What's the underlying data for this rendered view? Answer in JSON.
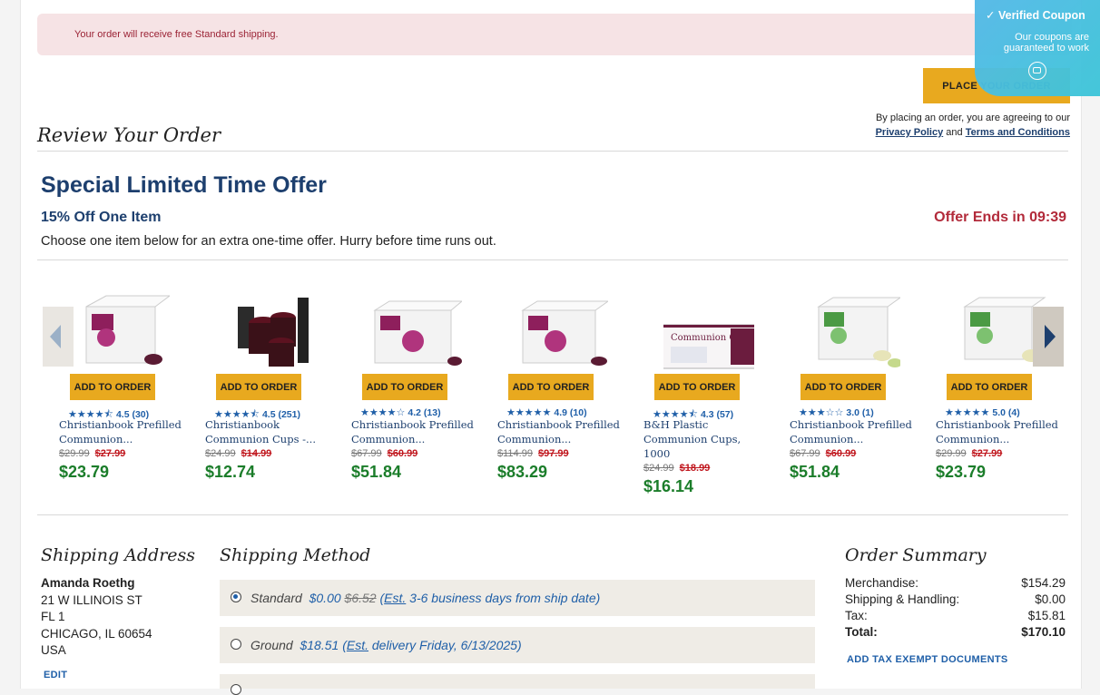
{
  "banner": {
    "text": "Your order will receive free Standard shipping."
  },
  "header": {
    "place_order_label": "PLACE YOUR ORDER",
    "agreement_text": "By placing an order, you are agreeing to our",
    "privacy_link": "Privacy Policy",
    "and_text": "and",
    "terms_link": "Terms and Conditions"
  },
  "review": {
    "title": "Review Your Order"
  },
  "offer": {
    "title": "Special Limited Time Offer",
    "subtitle": "15% Off One Item",
    "ends": "Offer Ends in 09:39",
    "description": "Choose one item below for an extra one-time offer. Hurry before time runs out."
  },
  "products": [
    {
      "add_label": "ADD TO ORDER",
      "stars": "★★★★⯪",
      "reviews": "4.5 (30)",
      "title1": "Christianbook Prefilled",
      "title2": "Communion...",
      "title3": "",
      "was": "$29.99",
      "sale": "$27.99",
      "offer_price": "$23.79"
    },
    {
      "add_label": "ADD TO ORDER",
      "stars": "★★★★⯪",
      "reviews": "4.5 (251)",
      "title1": "Christianbook",
      "title2": "Communion Cups -...",
      "title3": "",
      "was": "$24.99",
      "sale": "$14.99",
      "offer_price": "$12.74"
    },
    {
      "add_label": "ADD TO ORDER",
      "stars": "★★★★☆",
      "reviews": "4.2 (13)",
      "title1": "Christianbook Prefilled",
      "title2": "Communion...",
      "title3": "",
      "was": "$67.99",
      "sale": "$60.99",
      "offer_price": "$51.84"
    },
    {
      "add_label": "ADD TO ORDER",
      "stars": "★★★★★",
      "reviews": "4.9 (10)",
      "title1": "Christianbook Prefilled",
      "title2": "Communion...",
      "title3": "",
      "was": "$114.99",
      "sale": "$97.99",
      "offer_price": "$83.29"
    },
    {
      "add_label": "ADD TO ORDER",
      "stars": "★★★★⯪",
      "reviews": "4.3 (57)",
      "title1": "B&H Plastic",
      "title2": "Communion Cups,",
      "title3": "1000",
      "was": "$24.99",
      "sale": "$18.99",
      "offer_price": "$16.14",
      "box_label": "Communion Cups"
    },
    {
      "add_label": "ADD TO ORDER",
      "stars": "★★★☆☆",
      "reviews": "3.0 (1)",
      "title1": "Christianbook Prefilled",
      "title2": "Communion...",
      "title3": "",
      "was": "$67.99",
      "sale": "$60.99",
      "offer_price": "$51.84"
    },
    {
      "add_label": "ADD TO ORDER",
      "stars": "★★★★★",
      "reviews": "5.0 (4)",
      "title1": "Christianbook Prefilled",
      "title2": "Communion...",
      "title3": "",
      "was": "$29.99",
      "sale": "$27.99",
      "offer_price": "$23.79"
    }
  ],
  "shipping_address": {
    "heading": "Shipping Address",
    "name": "Amanda Roethg",
    "line1": "21 W ILLINOIS ST",
    "line2": "FL 1",
    "line3": "CHICAGO, IL 60654",
    "line4": "USA",
    "edit_label": "EDIT"
  },
  "shipping_method": {
    "heading": "Shipping Method",
    "options": [
      {
        "name": "Standard",
        "price": "$0.00",
        "old_price": "$6.52",
        "est_prefix": "(",
        "est": "Est.",
        "detail": " 3-6 business days from ship date)",
        "selected": true
      },
      {
        "name": "Ground",
        "price": "$18.51",
        "old_price": "",
        "est_prefix": "(",
        "est": "Est.",
        "detail": " delivery Friday, 6/13/2025)",
        "selected": false
      }
    ]
  },
  "order_summary": {
    "heading": "Order Summary",
    "rows": [
      {
        "label": "Merchandise:",
        "value": "$154.29"
      },
      {
        "label": "Shipping & Handling:",
        "value": "$0.00"
      },
      {
        "label": "Tax:",
        "value": "$15.81"
      },
      {
        "label": "Total:",
        "value": "$170.10"
      }
    ],
    "tax_exempt_label": "ADD TAX EXEMPT DOCUMENTS"
  },
  "coupon_widget": {
    "title": "Verified Coupon",
    "subtitle": "Our coupons are guaranteed to work"
  },
  "colors": {
    "accent_gold": "#e8a91f",
    "brand_navy": "#1d3f6e",
    "offer_green": "#1b7d2a",
    "sale_red": "#c0161d",
    "banner_pink": "#f6e3e5"
  }
}
